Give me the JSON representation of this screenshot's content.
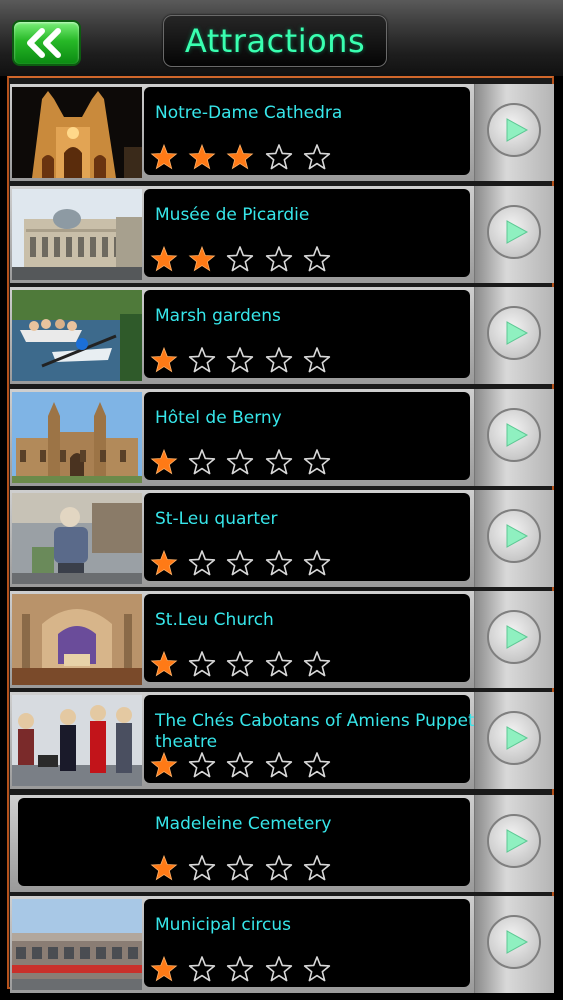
{
  "header": {
    "title": "Attractions",
    "back_icon": "double-chevron-left-icon",
    "accent_color": "#39ffb0",
    "back_color": "#27b827"
  },
  "list": {
    "name_color": "#37e6ea",
    "star_filled_color": "#ff7a16",
    "items": [
      {
        "name": "Notre-Dame Cathedra",
        "rating": 3,
        "thumb": "cathedral-night"
      },
      {
        "name": "Musée de Picardie",
        "rating": 2,
        "thumb": "museum-building"
      },
      {
        "name": "Marsh gardens",
        "rating": 1,
        "thumb": "boat-canal"
      },
      {
        "name": "Hôtel de Berny",
        "rating": 1,
        "thumb": "gothic-building"
      },
      {
        "name": "St-Leu quarter",
        "rating": 1,
        "thumb": "statue-street"
      },
      {
        "name": "St.Leu Church",
        "rating": 1,
        "thumb": "church-interior"
      },
      {
        "name": "The Chés Cabotans of Amiens Puppet theatre",
        "rating": 1,
        "thumb": "puppets"
      },
      {
        "name": "Madeleine Cemetery",
        "rating": 1,
        "thumb": ""
      },
      {
        "name": "Municipal circus",
        "rating": 1,
        "thumb": "circus-building"
      }
    ]
  }
}
